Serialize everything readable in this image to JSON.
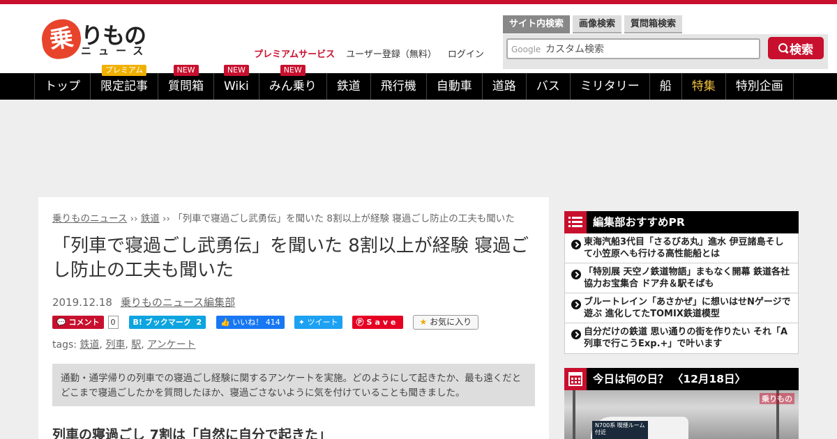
{
  "header": {
    "logo_kanji": "乗",
    "logo_text": "りもの",
    "logo_sub": "ニュース",
    "search_tabs": [
      "サイト内検索",
      "画像検索",
      "質問箱検索"
    ],
    "search_google_label": "Google",
    "search_placeholder": "カスタム検索",
    "search_button": "検索",
    "links": {
      "premium": "プレミアムサービス",
      "register": "ユーザー登録（無料）",
      "login": "ログイン"
    }
  },
  "nav": {
    "items": [
      "トップ",
      "限定記事",
      "質問箱",
      "Wiki",
      "みん乗り",
      "鉄道",
      "飛行機",
      "自動車",
      "道路",
      "バス",
      "ミリタリー",
      "船",
      "特集",
      "特別企画"
    ],
    "badges": {
      "premium": "プレミアム",
      "new": "NEW"
    }
  },
  "article": {
    "breadcrumb": {
      "home": "乗りものニュース",
      "sep": "››",
      "category": "鉄道",
      "current": "「列車で寝過ごし武勇伝」を聞いた 8割以上が経験 寝過ごし防止の工夫も聞いた"
    },
    "title": "「列車で寝過ごし武勇伝」を聞いた 8割以上が経験 寝過ごし防止の工夫も聞いた",
    "date": "2019.12.18",
    "author": "乗りものニュース編集部",
    "social": {
      "comment": "コメント",
      "comment_count": "0",
      "hatena": "B! ブックマーク",
      "hatena_count": "2",
      "like": "いいね！",
      "like_count": "414",
      "tweet": "ツイート",
      "pin": "Save",
      "favorite": "お気に入り"
    },
    "tags_label": "tags:",
    "tags": [
      "鉄道",
      "列車",
      "駅",
      "アンケート"
    ],
    "summary": "通勤・通学帰りの列車での寝過ごし経験に関するアンケートを実施。どのようにして起きたか、最も遠くだとどこまで寝過ごしたかを質問したほか、寝過ごさないように気を付けていることも聞きました。",
    "heading": "列車の寝過ごし 7割は「自然に自分で起きた」"
  },
  "sidebar": {
    "recommend_title": "編集部おすすめPR",
    "recommend": [
      "東海汽船3代目「さるびあ丸」進水 伊豆諸島そして小笠原へも行ける高性能船とは",
      "「特別展 天空ノ鉄道物語」まもなく開幕 鉄道各社協力お宝集合 ドア弁＆駅そばも",
      "ブルートレイン「あさかぜ」に想いはせNゲージで遊ぶ 進化してたTOMIX鉄道模型",
      "自分だけの鉄道 思い通りの街を作りたい それ「A列車で行こうExp.+」で叶います"
    ],
    "today_title": "今日は何の日？ 〈12月18日〉",
    "today_watermark": "乗りもの",
    "today_sign": "N700系 喫煙ルーム付近"
  }
}
